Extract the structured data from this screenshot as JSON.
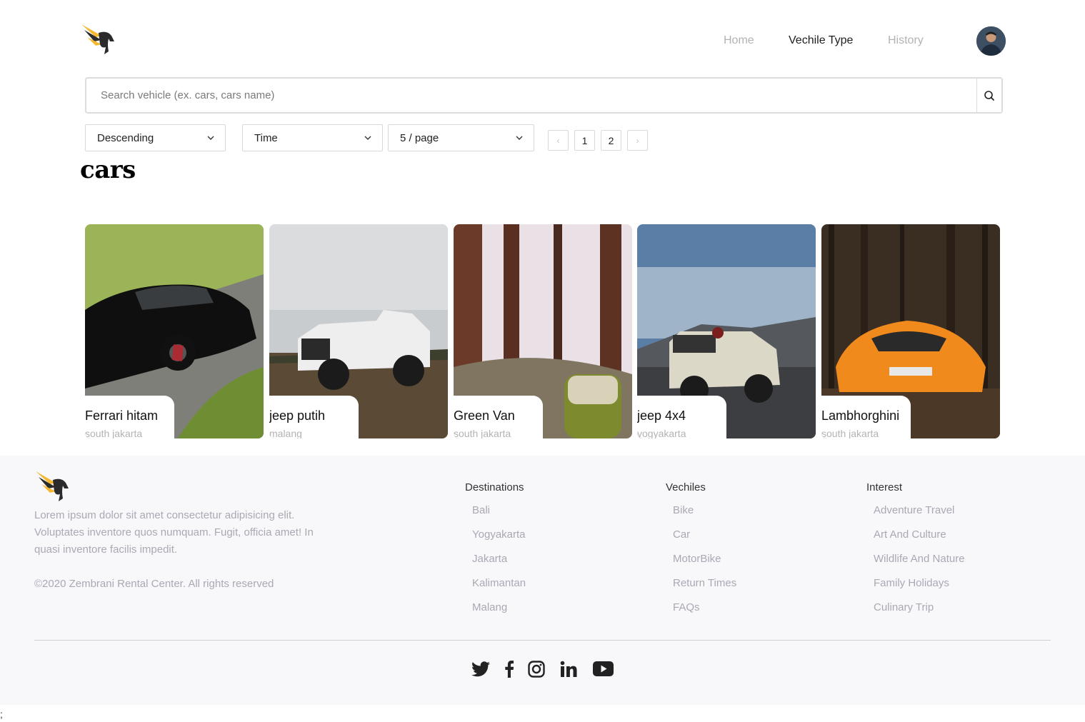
{
  "header": {
    "nav": [
      {
        "label": "Home",
        "active": false
      },
      {
        "label": "Vechile Type",
        "active": true
      },
      {
        "label": "History",
        "active": false
      }
    ]
  },
  "search": {
    "placeholder": "Search vehicle (ex. cars, cars name)",
    "value": ""
  },
  "filters": {
    "sort_order": "Descending",
    "sort_by": "Time",
    "page_size": "5 / page"
  },
  "pagination": {
    "prev": "‹",
    "pages": [
      "1",
      "2"
    ],
    "next": "›"
  },
  "section_title": "cars",
  "cards": [
    {
      "name": "Ferrari hitam",
      "location": "south jakarta"
    },
    {
      "name": "jeep putih",
      "location": "malang"
    },
    {
      "name": "Green Van",
      "location": "south jakarta"
    },
    {
      "name": "jeep 4x4",
      "location": "yogyakarta"
    },
    {
      "name": "Lambhorghini",
      "location": "south jakarta"
    }
  ],
  "footer": {
    "description": "Lorem ipsum dolor sit amet consectetur adipisicing elit. Voluptates inventore quos numquam. Fugit, officia amet! In quasi inventore facilis impedit.",
    "copyright": "©2020 Zembrani Rental Center. All rights reserved",
    "columns": [
      {
        "title": "Destinations",
        "links": [
          "Bali",
          "Yogyakarta",
          "Jakarta",
          "Kalimantan",
          "Malang"
        ]
      },
      {
        "title": "Vechiles",
        "links": [
          "Bike",
          "Car",
          "MotorBike",
          "Return Times",
          "FAQs"
        ]
      },
      {
        "title": "Interest",
        "links": [
          "Adventure Travel",
          "Art And Culture",
          "Wildlife And Nature",
          "Family Holidays",
          "Culinary Trip"
        ]
      }
    ],
    "social_icons": [
      "twitter-icon",
      "facebook-icon",
      "instagram-icon",
      "linkedin-icon",
      "youtube-icon"
    ]
  },
  "stray_text": ";",
  "colors": {
    "accent": "#f5b82e",
    "muted_text": "#a9a9b5",
    "footer_bg": "#f8f8fa"
  }
}
